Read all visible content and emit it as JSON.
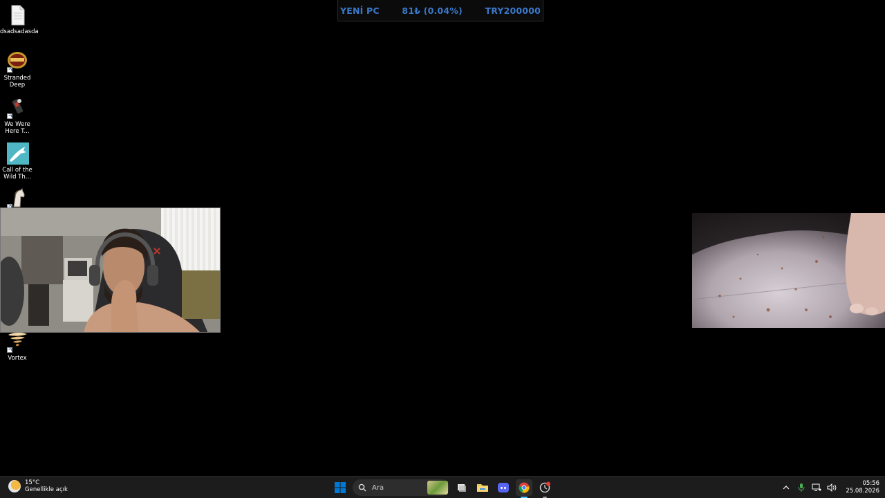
{
  "goal": {
    "title": "YENİ PC",
    "current": "81₺ (0.04%)",
    "target": "TRY200000"
  },
  "desktop_icons": [
    {
      "label": "dsadsadasda",
      "icon": "document-icon"
    },
    {
      "label": "Stranded Deep",
      "icon": "stranded-deep-icon"
    },
    {
      "label": "We Were Here T...",
      "icon": "we-were-here-icon"
    },
    {
      "label": "Call of the Wild Th...",
      "icon": "call-of-the-wild-icon"
    },
    {
      "label": "",
      "icon": "horse-game-icon"
    },
    {
      "label": "Vortex",
      "icon": "vortex-icon"
    }
  ],
  "webcams": [
    {
      "name": "face-cam",
      "description_icon": "webcam-feed"
    },
    {
      "name": "floor-cam",
      "description_icon": "webcam-feed"
    }
  ],
  "taskbar": {
    "weather": {
      "temp": "15°C",
      "condition": "Genellikle açık",
      "icon": "weather-partly-sunny-icon"
    },
    "search_placeholder": "Ara",
    "pinned": [
      {
        "name": "start",
        "icon": "windows-start-icon"
      },
      {
        "name": "task-view",
        "icon": "task-view-icon"
      },
      {
        "name": "file-explorer",
        "icon": "folder-icon"
      },
      {
        "name": "discord",
        "icon": "discord-icon"
      },
      {
        "name": "chrome",
        "icon": "chrome-icon"
      },
      {
        "name": "obs-recording",
        "icon": "record-icon"
      }
    ],
    "tray": {
      "time": "05:56",
      "date": "25.08.2026"
    }
  },
  "colors": {
    "goal_text": "#3b78c9",
    "taskbar_bg": "#1c1c1c",
    "windows_blue": "#0078d4",
    "discord": "#5865f2",
    "folder": "#f2c94c",
    "active_indicator": "#4cc2ff"
  }
}
